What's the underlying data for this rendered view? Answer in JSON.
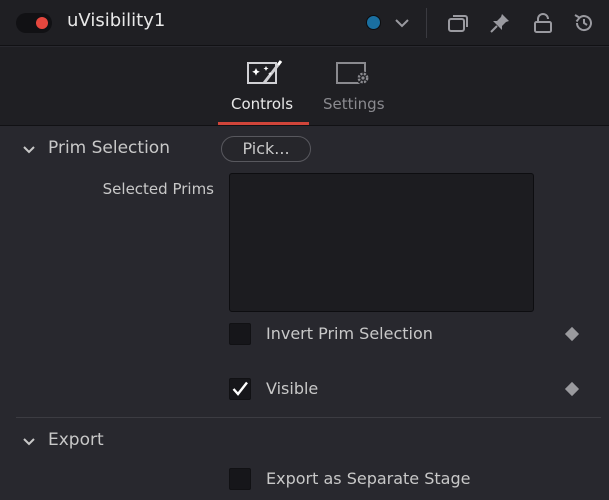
{
  "header": {
    "title": "uVisibility1",
    "toggle_color": "#e5473e",
    "node_color": "#1a6fa0",
    "icons": [
      "color-dropdown-chevron-icon",
      "versions-icon",
      "pin-icon",
      "lock-icon",
      "reset-icon"
    ]
  },
  "tabs": [
    {
      "label": "Controls",
      "icon": "magic-wand-icon",
      "active": true
    },
    {
      "label": "Settings",
      "icon": "settings-gear-icon",
      "active": false
    }
  ],
  "sections": {
    "prim_selection": {
      "title": "Prim Selection",
      "pick_label": "Pick...",
      "selected_prims_label": "Selected Prims",
      "selected_prims_value": "",
      "invert_label": "Invert Prim Selection",
      "invert_checked": false,
      "visible_label": "Visible",
      "visible_checked": true
    },
    "export": {
      "title": "Export",
      "separate_stage_label": "Export as Separate Stage",
      "separate_stage_checked": false
    }
  },
  "colors": {
    "accent_underline": "#d0453a",
    "background": "#28282e",
    "header_background": "#1f1f23"
  }
}
